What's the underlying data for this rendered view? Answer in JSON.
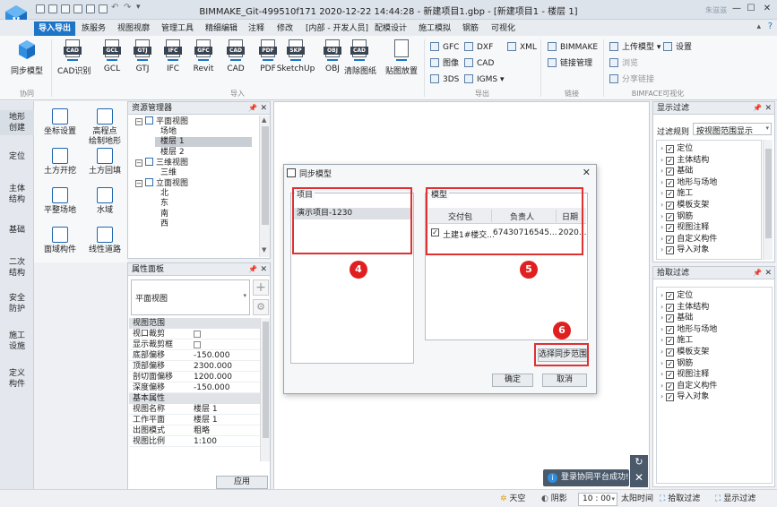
{
  "titlebar": {
    "title": "BIMMAKE_Git-499510f171 2020-12-22 14:44:28 - 新建项目1.gbp - [新建项目1 - 楼层 1]",
    "user": "朱滋滋",
    "controls": {
      "minimize": "—",
      "maximize": "☐",
      "close": "✕"
    }
  },
  "menu": [
    "导入导出",
    "族服务",
    "视图视廓",
    "管理工具",
    "精细编辑",
    "注释",
    "修改",
    "[内部 - 开发人员]",
    "配模设计",
    "施工模拟",
    "钢筋",
    "可视化"
  ],
  "ribbon": {
    "sync": {
      "label": "同步模型",
      "group": "协同"
    },
    "import_buttons": [
      {
        "tag": "CAD",
        "label": "CAD识别"
      },
      {
        "tag": "GCL",
        "label": "GCL"
      },
      {
        "tag": "GTJ",
        "label": "GTJ"
      },
      {
        "tag": "IFC",
        "label": "IFC"
      },
      {
        "tag": "GFC",
        "label": "Revit"
      },
      {
        "tag": "CAD",
        "label": "CAD"
      },
      {
        "tag": "PDF",
        "label": "PDF"
      },
      {
        "tag": "SKP",
        "label": "SketchUp"
      },
      {
        "tag": "OBJ",
        "label": "OBJ"
      },
      {
        "tag": "CAD",
        "label": "清除图纸"
      },
      {
        "tag": "",
        "label": "贴图放置"
      }
    ],
    "import_group": "导入",
    "export_small": [
      "GFC",
      "DXF",
      "XML",
      "图像",
      "CAD",
      "3DS",
      "IGMS"
    ],
    "export_group": "导出",
    "link_small": [
      "BIMMAKE",
      "链接管理"
    ],
    "link_group": "链接",
    "bimface_small": [
      "上传模型",
      "设置",
      "浏览",
      "分享链接"
    ],
    "bimface_group": "BIMFACE可视化"
  },
  "leftstrip": [
    "地形\n创建",
    "定位",
    "主体\n结构",
    "基础",
    "二次\n结构",
    "安全\n防护",
    "施工\n设施",
    "定义\n构件"
  ],
  "tools": [
    {
      "label": "坐标设置"
    },
    {
      "label": "高程点\n绘制地形"
    },
    {
      "label": "土方开挖"
    },
    {
      "label": "土方回填"
    },
    {
      "label": "平整场地"
    },
    {
      "label": "水域"
    },
    {
      "label": "面域构件"
    },
    {
      "label": "线性道路"
    }
  ],
  "resource_panel": {
    "title": "资源管理器",
    "tree": [
      {
        "text": "平面视图",
        "level": 1,
        "exp": "−"
      },
      {
        "text": "场地",
        "level": 2
      },
      {
        "text": "楼层 1",
        "level": 2,
        "selected": true
      },
      {
        "text": "楼层 2",
        "level": 2
      },
      {
        "text": "三维视图",
        "level": 1,
        "exp": "−"
      },
      {
        "text": "三维",
        "level": 2
      },
      {
        "text": "立面视图",
        "level": 1,
        "exp": "−"
      },
      {
        "text": "北",
        "level": 2
      },
      {
        "text": "东",
        "level": 2
      },
      {
        "text": "南",
        "level": 2
      },
      {
        "text": "西",
        "level": 2
      }
    ]
  },
  "props_panel": {
    "title": "属性面板",
    "type": "平面视图",
    "sections": [
      {
        "name": "视图范围",
        "rows": [
          {
            "k": "视口裁剪",
            "v": "",
            "cb": true
          },
          {
            "k": "显示裁剪框",
            "v": "",
            "cb": true
          },
          {
            "k": "底部偏移",
            "v": "-150.000"
          },
          {
            "k": "顶部偏移",
            "v": "2300.000"
          },
          {
            "k": "剖切面偏移",
            "v": "1200.000"
          },
          {
            "k": "深度偏移",
            "v": "-150.000"
          }
        ]
      },
      {
        "name": "基本属性",
        "rows": [
          {
            "k": "视图名称",
            "v": "楼层 1"
          },
          {
            "k": "工作平面",
            "v": "楼层 1"
          },
          {
            "k": "出图模式",
            "v": "粗略"
          },
          {
            "k": "视图比例",
            "v": "1:100"
          }
        ]
      }
    ],
    "apply": "应用"
  },
  "dialog": {
    "title": "同步模型",
    "project_label": "项目",
    "project_item": "演示项目-1230",
    "model_label": "模型",
    "columns": [
      "交付包",
      "负责人",
      "日期"
    ],
    "row": [
      "土建1#楼交...",
      "67430716545...",
      "2020..."
    ],
    "select_range": "选择同步范围",
    "ok": "确定",
    "cancel": "取消"
  },
  "badges": [
    "4",
    "5",
    "6"
  ],
  "display_filter": {
    "title": "显示过滤",
    "rule_label": "过滤规则",
    "rule_value": "按视图范围显示",
    "items": [
      "定位",
      "主体结构",
      "基础",
      "地形与场地",
      "施工",
      "模板支架",
      "钢筋",
      "视图注释",
      "自定义构件",
      "导入对象"
    ]
  },
  "pick_filter": {
    "title": "拾取过滤",
    "items": [
      "定位",
      "主体结构",
      "基础",
      "地形与场地",
      "施工",
      "模板支架",
      "钢筋",
      "视图注释",
      "自定义构件",
      "导入对象"
    ]
  },
  "toast": {
    "text": "登录协同平台成功!"
  },
  "statusbar": {
    "sky": "天空",
    "shadow": "阴影",
    "time": "10 : 00",
    "sun_time": "太阳时间",
    "pick_filter": "拾取过滤",
    "display_filter": "显示过滤"
  },
  "colors": {
    "accent": "#1d75c8",
    "red": "#e02020"
  }
}
